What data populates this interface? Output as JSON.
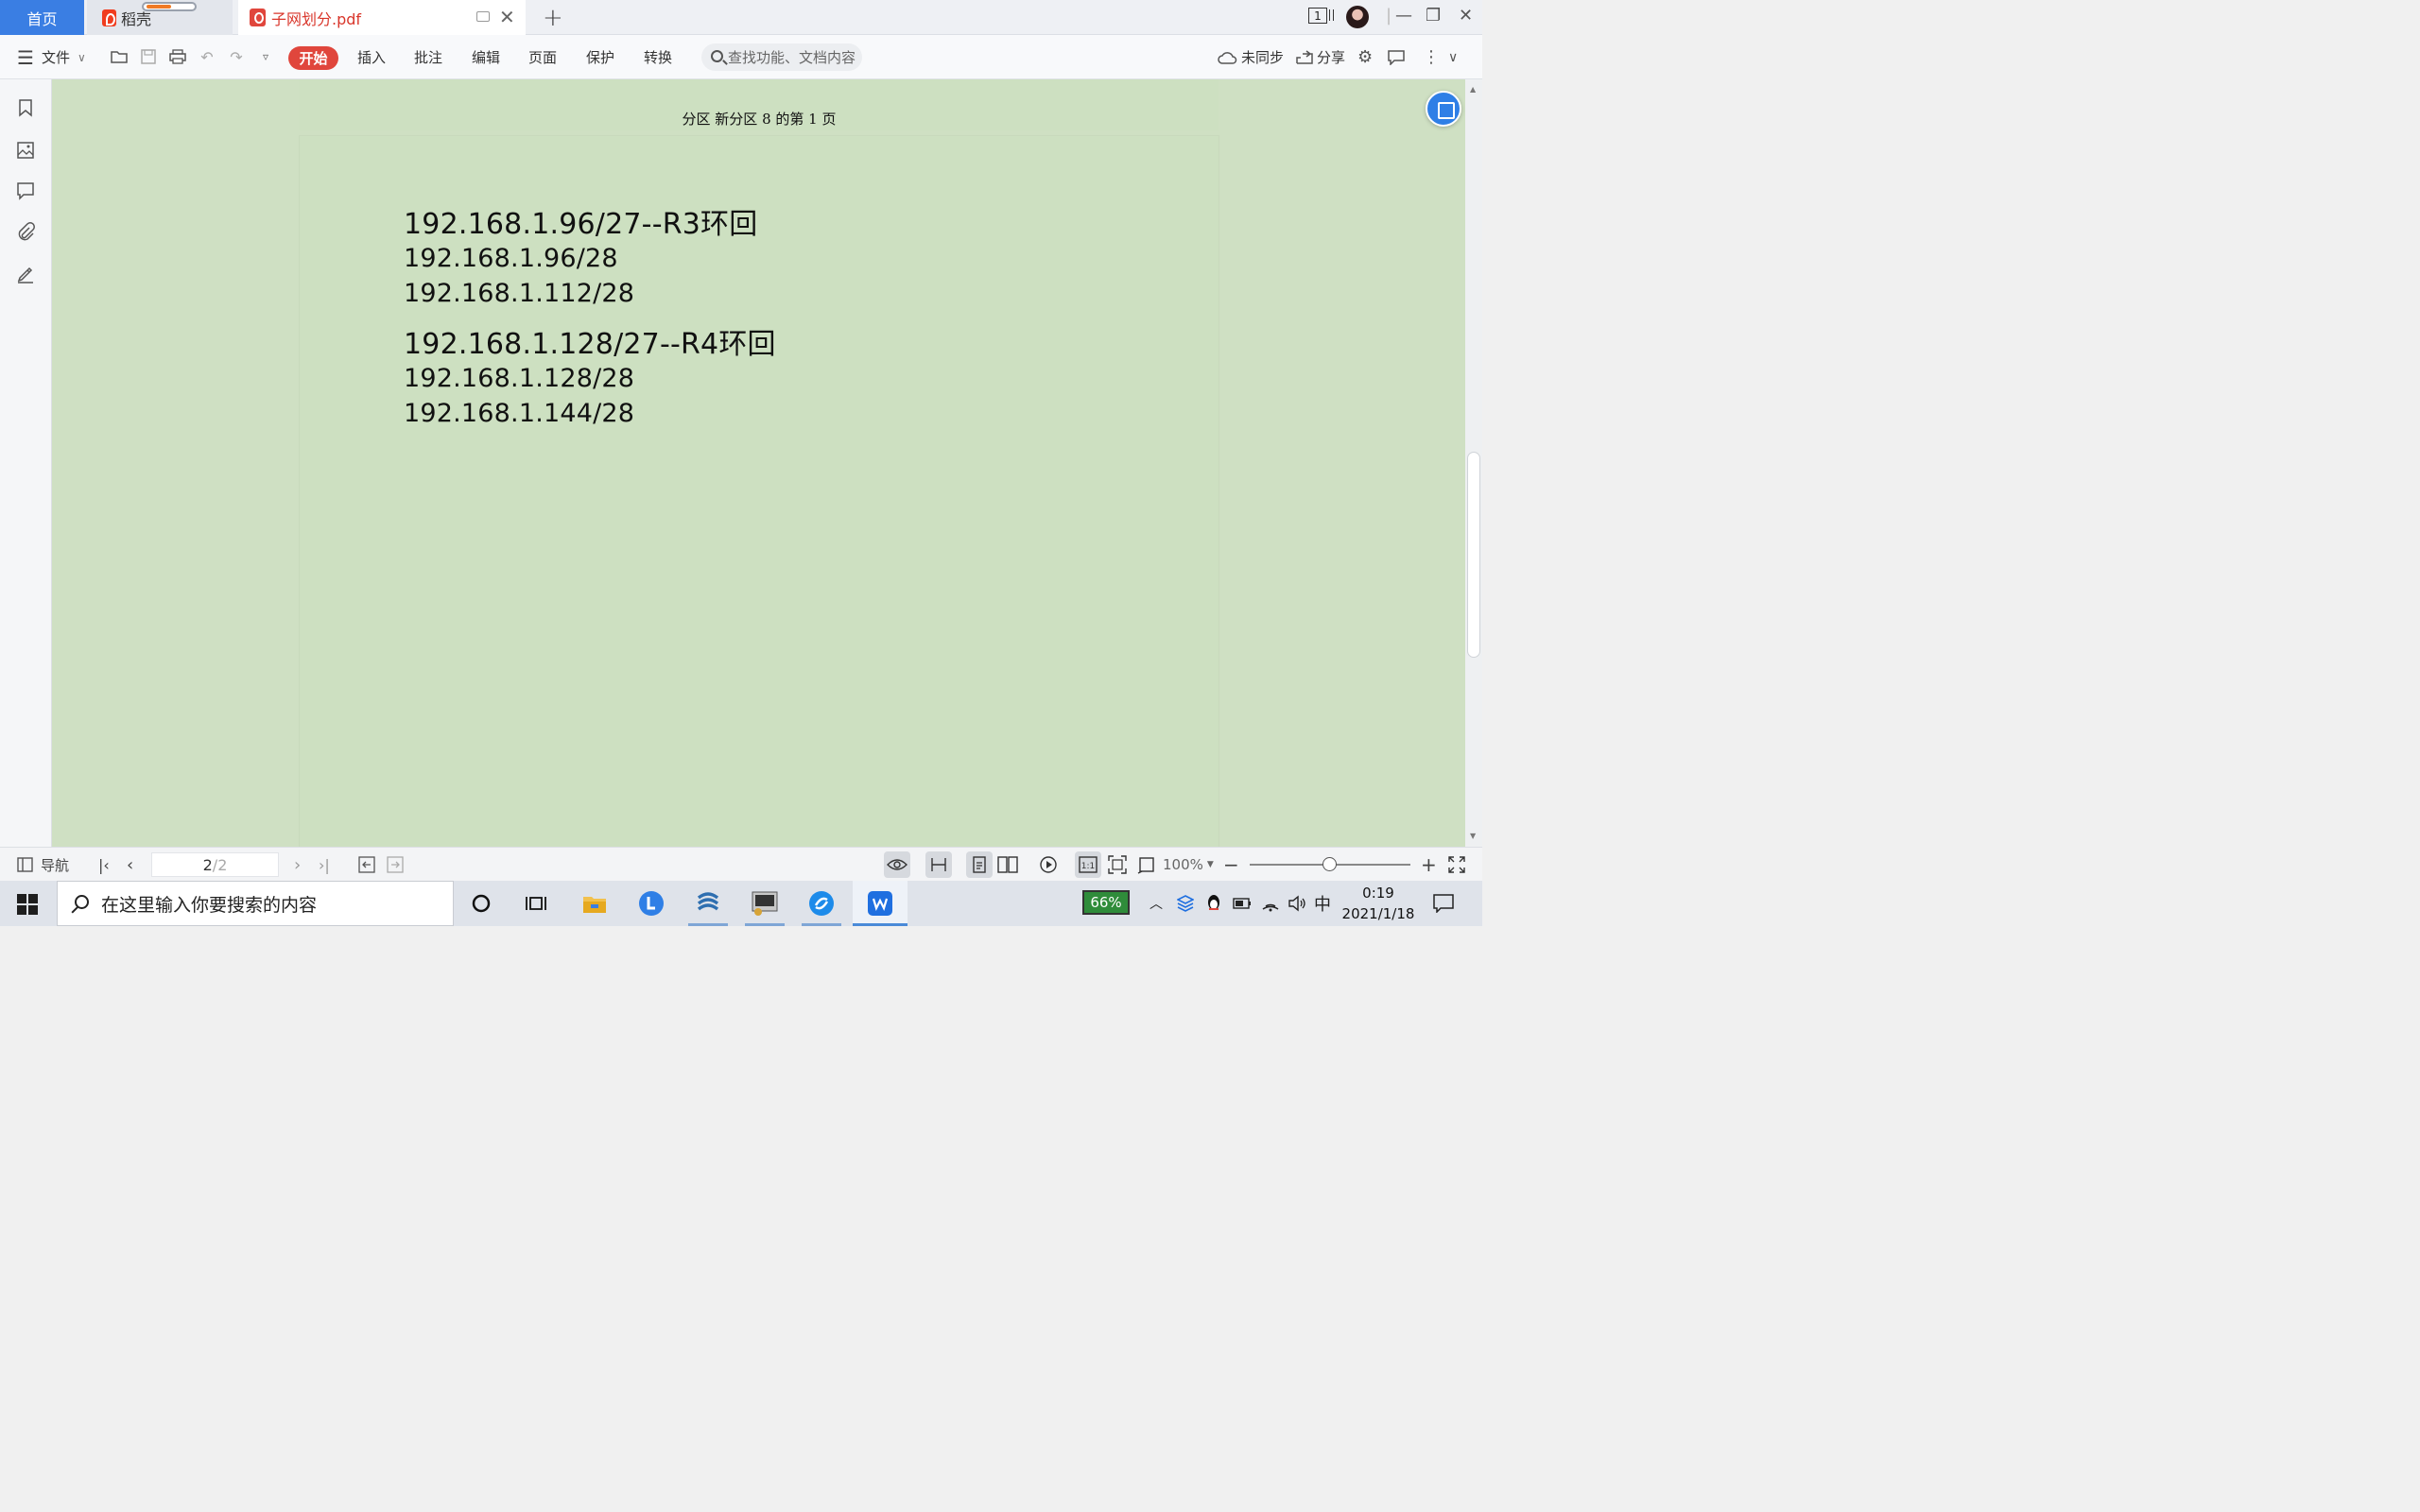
{
  "tabs": {
    "home": "首页",
    "daoke": "稻壳",
    "document": "子网划分.pdf",
    "window_count": "1"
  },
  "toolbar": {
    "file_menu": "文件",
    "items": [
      "开始",
      "插入",
      "批注",
      "编辑",
      "页面",
      "保护",
      "转换"
    ],
    "search_placeholder": "查找功能、文档内容",
    "sync": "未同步",
    "share": "分享"
  },
  "document": {
    "header": "分区 新分区 8 的第 1 页",
    "lines": [
      "192.168.1.96/27--R3环回",
      "192.168.1.96/28",
      "192.168.1.112/28",
      "192.168.1.128/27--R4环回",
      "192.168.1.128/28",
      "192.168.1.144/28"
    ]
  },
  "statusbar": {
    "nav": "导航",
    "page_current": "2",
    "page_total": "/2",
    "zoom": "100%",
    "zoom_level_percent": 50
  },
  "taskbar": {
    "search_placeholder": "在这里输入你要搜索的内容",
    "battery": "66%",
    "ime": "中",
    "time": "0:19",
    "date": "2021/1/18"
  },
  "colors": {
    "accent_blue": "#3a7ee3",
    "start_red": "#e0463c",
    "doc_background": "#cde0c1"
  }
}
